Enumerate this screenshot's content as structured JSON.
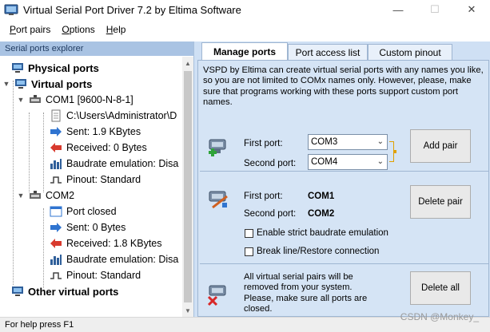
{
  "window": {
    "title": "Virtual Serial Port Driver 7.2 by Eltima Software",
    "controls": {
      "minimize": "—",
      "maximize": "☐",
      "close": "✕"
    }
  },
  "menu": [
    {
      "label": "Port pairs",
      "mnemonic": "P",
      "rest": "ort pairs"
    },
    {
      "label": "Options",
      "mnemonic": "O",
      "rest": "ptions"
    },
    {
      "label": "Help",
      "mnemonic": "H",
      "rest": "elp"
    }
  ],
  "explorer": {
    "header": "Serial ports explorer",
    "tree": {
      "physical": "Physical ports",
      "virtual": "Virtual ports",
      "com1": {
        "label": "COM1 [9600-N-8-1]",
        "path": "C:\\Users\\Administrator\\D",
        "sent": "Sent: 1.9 KBytes",
        "received": "Received: 0 Bytes",
        "baud": "Baudrate emulation: Disa",
        "pinout": "Pinout: Standard"
      },
      "com2": {
        "label": "COM2",
        "status": "Port closed",
        "sent": "Sent: 0 Bytes",
        "received": "Received: 1.8 KBytes",
        "baud": "Baudrate emulation: Disa",
        "pinout": "Pinout: Standard"
      },
      "other": "Other virtual ports"
    }
  },
  "tabs": [
    {
      "label": "Manage ports",
      "active": true
    },
    {
      "label": "Port access list",
      "active": false
    },
    {
      "label": "Custom pinout",
      "active": false
    }
  ],
  "manage": {
    "intro": "VSPD by Eltima can create virtual serial ports with any names you like, so you are not limited to COMx names only. However, please, make sure that programs working with these ports support custom port names.",
    "add": {
      "first_label": "First port:",
      "first_value": "COM3",
      "second_label": "Second port:",
      "second_value": "COM4",
      "button": "Add pair"
    },
    "delete": {
      "first_label": "First port:",
      "first_value": "COM1",
      "second_label": "Second port:",
      "second_value": "COM2",
      "button": "Delete pair",
      "chk_baud": "Enable strict baudrate emulation",
      "chk_break": "Break line/Restore connection"
    },
    "delete_all": {
      "text": "All virtual serial pairs will be removed from your system. Please, make sure all ports are closed.",
      "button": "Delete all"
    }
  },
  "status": {
    "text": "For help press F1"
  },
  "watermark": "CSDN @Monkey_"
}
